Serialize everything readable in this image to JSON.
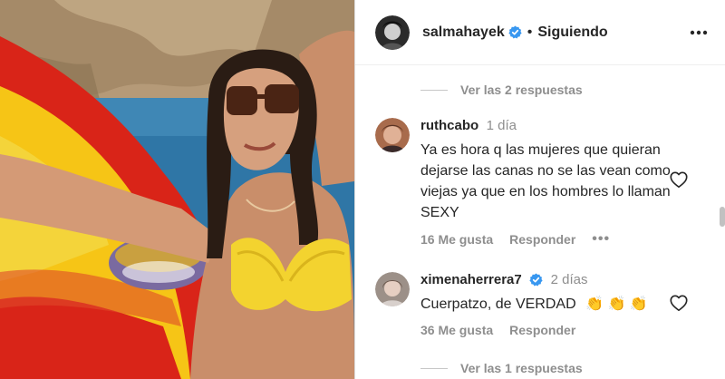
{
  "post": {
    "author": "salmahayek",
    "separator": "•",
    "follow_status": "Siguiendo",
    "more_icon": "more-horizontal-icon",
    "verified_icon": "verified-badge-icon",
    "colors": {
      "verified": "#3897f0",
      "text": "#262626",
      "muted": "#8e8e8e"
    }
  },
  "comments": {
    "top_replies_toggle": "Ver las 2 respuestas",
    "items": [
      {
        "user": "ruthcabo",
        "verified": false,
        "time": "1 día",
        "text": "Ya es hora q las mujeres que quieran dejarse las canas no se las vean como viejas ya que en los hombres lo llaman SEXY",
        "likes": "16 Me gusta",
        "reply": "Responder",
        "more": "•••"
      },
      {
        "user": "ximenaherrera7",
        "verified": true,
        "time": "2 días",
        "text": "Cuerpatzo, de VERDAD",
        "emoji": "👏 👏 👏",
        "likes": "36 Me gusta",
        "reply": "Responder"
      }
    ],
    "bottom_replies_toggle": "Ver las 1 respuestas"
  }
}
